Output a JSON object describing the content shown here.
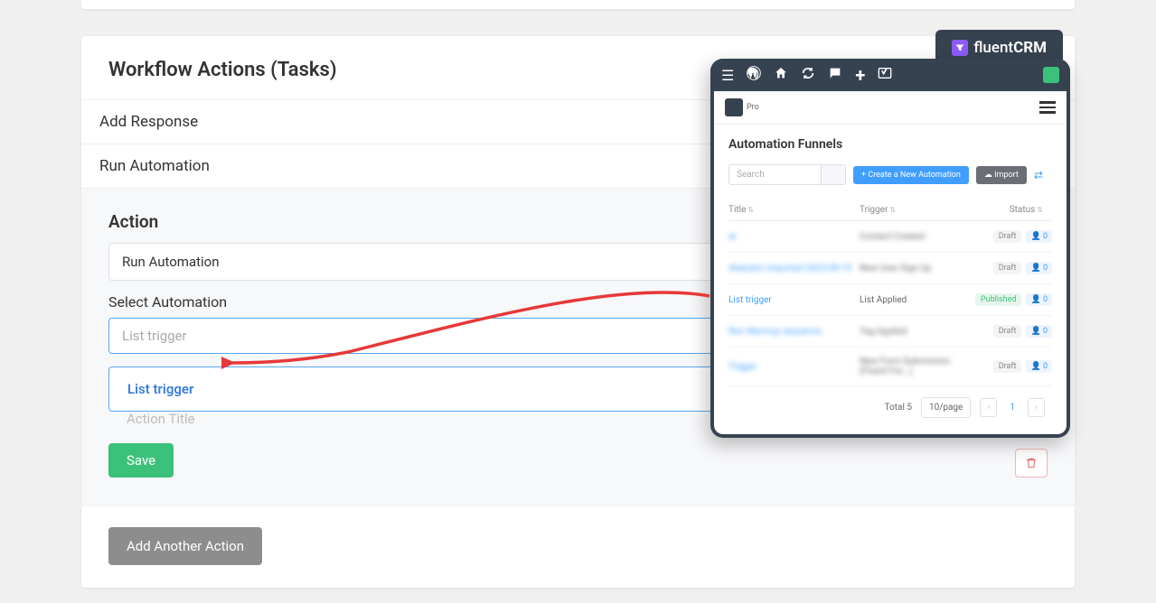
{
  "panel": {
    "title": "Workflow Actions (Tasks)",
    "add_response": "Add Response",
    "run_automation": "Run Automation"
  },
  "action": {
    "label": "Action",
    "select_value": "Run Automation",
    "auto_label": "Select Automation",
    "auto_placeholder": "List trigger",
    "dropdown_option": "List trigger",
    "hidden_text": "Action Title",
    "save": "Save",
    "add_another": "Add Another Action"
  },
  "popup": {
    "brand_prefix": "fluent",
    "brand_suffix": "CRM",
    "pro": "Pro",
    "funnel_title": "Automation Funnels",
    "search_placeholder": "Search",
    "create_label": "+   Create a New Automation",
    "import_label": "Import",
    "columns": {
      "title": "Title",
      "trigger": "Trigger",
      "status": "Status"
    },
    "rows": [
      {
        "title": "al",
        "trigger": "Contact Created",
        "status": "Draft",
        "count": "0"
      },
      {
        "title": "Abandon Imported 2022-08-19",
        "trigger": "New User Sign Up",
        "status": "Draft",
        "count": "0"
      },
      {
        "title": "List trigger",
        "trigger": "List Applied",
        "status": "Published",
        "count": "0"
      },
      {
        "title": "Run Warmup sequence",
        "trigger": "Tag Applied",
        "status": "Draft",
        "count": "0"
      },
      {
        "title": "Trigger",
        "trigger": "New Form Submission (Fluent For...)",
        "status": "Draft",
        "count": "0"
      }
    ],
    "total_label": "Total 5",
    "per_page": "10/page",
    "page": "1"
  }
}
